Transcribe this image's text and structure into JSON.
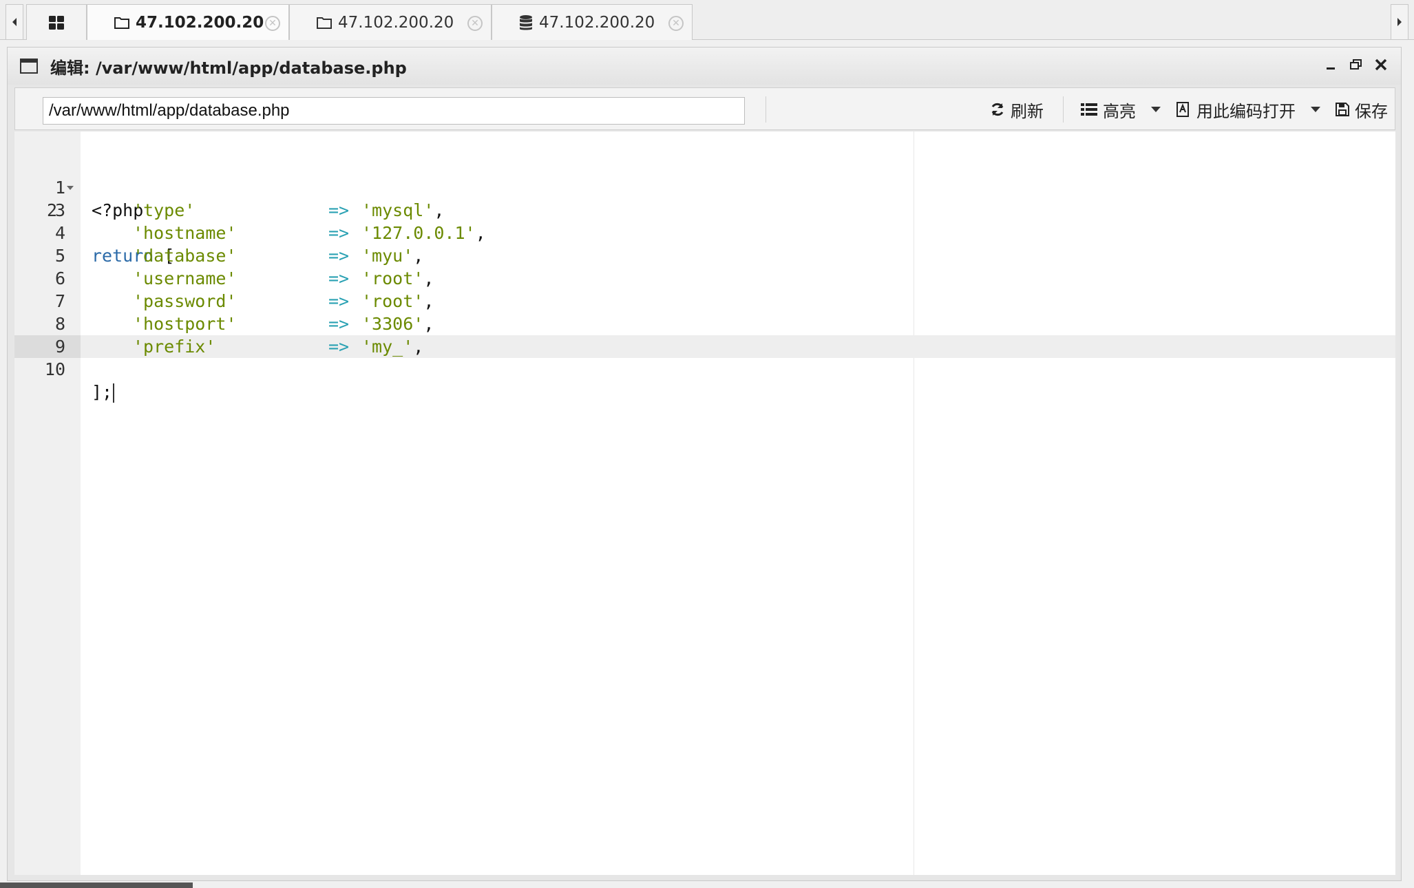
{
  "tabs": [
    {
      "label": "47.102.200.20",
      "icon": "folder-icon",
      "active": true
    },
    {
      "label": "47.102.200.20",
      "icon": "folder-icon",
      "active": false
    },
    {
      "label": "47.102.200.20",
      "icon": "database-icon",
      "active": false
    }
  ],
  "window": {
    "title": "编辑: /var/www/html/app/database.php"
  },
  "toolbar": {
    "path_value": "/var/www/html/app/database.php",
    "refresh_label": "刷新",
    "highlight_label": "高亮",
    "encoding_label": "用此编码打开",
    "save_label": "保存"
  },
  "editor": {
    "active_line": 10,
    "lines": [
      {
        "n": "1",
        "text": "<?php"
      },
      {
        "n": "2",
        "text": "return ["
      },
      {
        "n": "3",
        "key": "'type'",
        "value": "'mysql'"
      },
      {
        "n": "4",
        "key": "'hostname'",
        "value": "'127.0.0.1'"
      },
      {
        "n": "5",
        "key": "'database'",
        "value": "'myu'"
      },
      {
        "n": "6",
        "key": "'username'",
        "value": "'root'"
      },
      {
        "n": "7",
        "key": "'password'",
        "value": "'root'"
      },
      {
        "n": "8",
        "key": "'hostport'",
        "value": "'3306'"
      },
      {
        "n": "9",
        "key": "'prefix'",
        "value": "'my_'"
      },
      {
        "n": "10",
        "text": "];"
      }
    ],
    "arrow": "=>",
    "keyword": "return",
    "open_bracket": "["
  }
}
